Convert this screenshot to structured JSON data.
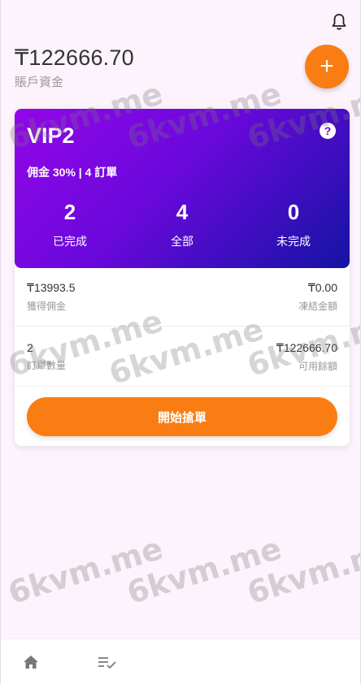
{
  "header": {
    "balance": "₸122666.70",
    "balance_label": "賬戶資金",
    "fab_label": "+"
  },
  "vip_card": {
    "level": "VIP2",
    "help": "?",
    "commission_line": "佣金 30% | 4 訂單",
    "stats": [
      {
        "value": "2",
        "label": "已完成"
      },
      {
        "value": "4",
        "label": "全部"
      },
      {
        "value": "0",
        "label": "未完成"
      }
    ]
  },
  "details": {
    "row1": {
      "left_value": "₸13993.5",
      "left_label": "獲得佣金",
      "right_value": "₸0.00",
      "right_label": "凍結金額"
    },
    "row2": {
      "left_value": "2",
      "left_label": "訂單數量",
      "right_value": "₸122666.70",
      "right_label": "可用餘額"
    }
  },
  "action": {
    "start_label": "開始搶單"
  },
  "watermark": "6kvm.me",
  "colors": {
    "accent": "#f97d12",
    "gradient_start": "#9306e8",
    "gradient_end": "#1414a3",
    "background": "#fcf3fd"
  },
  "bottom_nav": {
    "icons": [
      "home-icon",
      "list-check-icon"
    ]
  }
}
